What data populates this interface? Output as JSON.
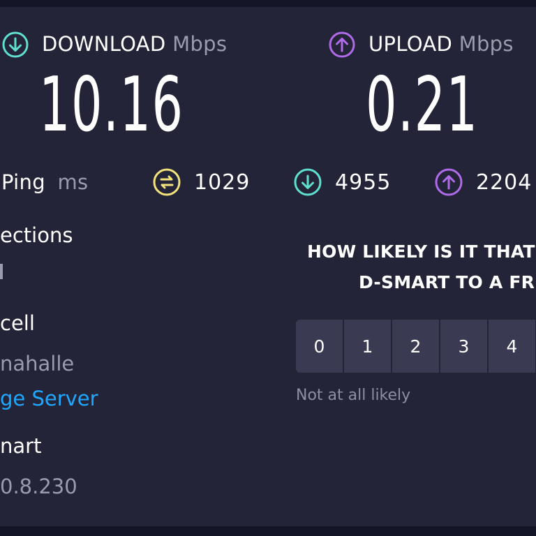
{
  "download": {
    "label": "DOWNLOAD",
    "unit": "Mbps",
    "value": "10.16"
  },
  "upload": {
    "label": "UPLOAD",
    "unit": "Mbps",
    "value": "0.21"
  },
  "ping": {
    "label": "Ping",
    "unit": "ms"
  },
  "stats": {
    "jitter": "1029",
    "download_latency": "4955",
    "upload_latency": "2204"
  },
  "info": {
    "connections_label": "ections",
    "isp_name": "cell",
    "isp_location": "nahalle",
    "change_server": "ge Server",
    "host_name": "nart",
    "host_ip": "0.8.230"
  },
  "survey": {
    "question_line1": "HOW LIKELY IS IT THAT",
    "question_line2": "D-SMART TO A FR",
    "options": [
      "0",
      "1",
      "2",
      "3",
      "4"
    ],
    "low_label": "Not at all likely"
  },
  "colors": {
    "download_accent": "#5fe0cf",
    "upload_accent": "#b06be8",
    "jitter_accent": "#f4e37a",
    "link": "#1fa8ff"
  },
  "icons": {
    "download": "download-arrow-icon",
    "upload": "upload-arrow-icon",
    "jitter": "jitter-icon"
  }
}
